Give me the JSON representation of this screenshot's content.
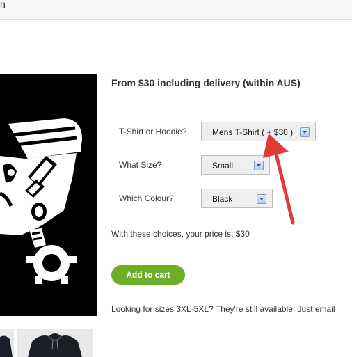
{
  "colors": {
    "accent_green": "#6cae2a",
    "arrow_red": "#e03b3b",
    "hero_background": "#000000"
  },
  "top": {
    "stub_text": "n"
  },
  "product": {
    "headline": "From $30 including delivery (within AUS)",
    "options": [
      {
        "label": "T-Shirt or Hoodie?",
        "selected": "Mens T-Shirt ( + $30 )"
      },
      {
        "label": "What Size?",
        "selected": "Small"
      },
      {
        "label": "Which Colour?",
        "selected": "Black"
      }
    ],
    "price_line": "With these choices, your price is: $30",
    "add_to_cart": "Add to cart",
    "sizes_note": "Looking for sizes 3XL-5XL? They're still available! Just email"
  },
  "icons": {
    "hero": "piston-character-artwork",
    "thumb1": "hoodie-thumbnail",
    "thumb2": "hoodie-thumbnail",
    "annotation": "red-arrow"
  }
}
